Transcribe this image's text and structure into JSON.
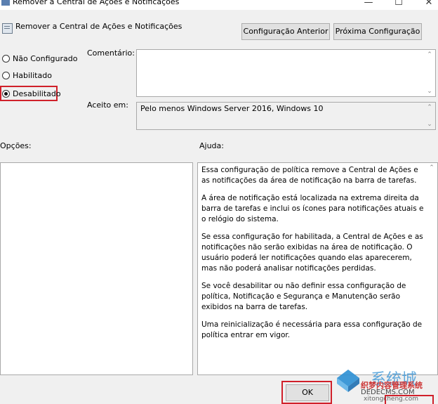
{
  "window": {
    "title": "Remover a Central de Ações e Notificações",
    "minimize": "—",
    "maximize": "☐",
    "close": "✕"
  },
  "header": {
    "title": "Remover a Central de Ações e Notificações",
    "prev_button": "Configuração Anterior",
    "next_button": "Próxima Configuração"
  },
  "radios": [
    {
      "label": "Não Configurado",
      "checked": false
    },
    {
      "label": "Habilitado",
      "checked": false
    },
    {
      "label": "Desabilitado",
      "checked": true
    }
  ],
  "comment": {
    "label": "Comentário:",
    "value": ""
  },
  "supported": {
    "label": "Aceito em:",
    "value": "Pelo menos Windows Server 2016, Windows 10"
  },
  "options": {
    "label": "Opções:"
  },
  "help": {
    "label": "Ajuda:",
    "paragraphs": [
      "Essa configuração de política remove a Central de Ações e as notificações da área de notificação na barra de tarefas.",
      "A área de notificação está localizada na extrema direita da barra de tarefas e inclui os ícones para notificações atuais e o relógio do sistema.",
      "Se essa configuração for habilitada, a Central de Ações e as notificações não serão exibidas na área de notificação. O usuário poderá ler notificações quando elas aparecerem, mas não poderá analisar notificações perdidas.",
      "Se você desabilitar ou não definir essa configuração de política, Notificação e Segurança e Manutenção serão exibidos na barra de tarefas.",
      "Uma reinicialização é necessária para essa configuração de política entrar em vigor."
    ]
  },
  "footer": {
    "ok_button": "OK"
  },
  "watermark": {
    "text1": "系统城",
    "text2": "织梦内容管理系统",
    "text3": "DEDECMS.COM",
    "text4": "xitongcheng.com"
  },
  "colors": {
    "highlight": "#d0202a",
    "dialog_bg": "#f0f0f0"
  }
}
